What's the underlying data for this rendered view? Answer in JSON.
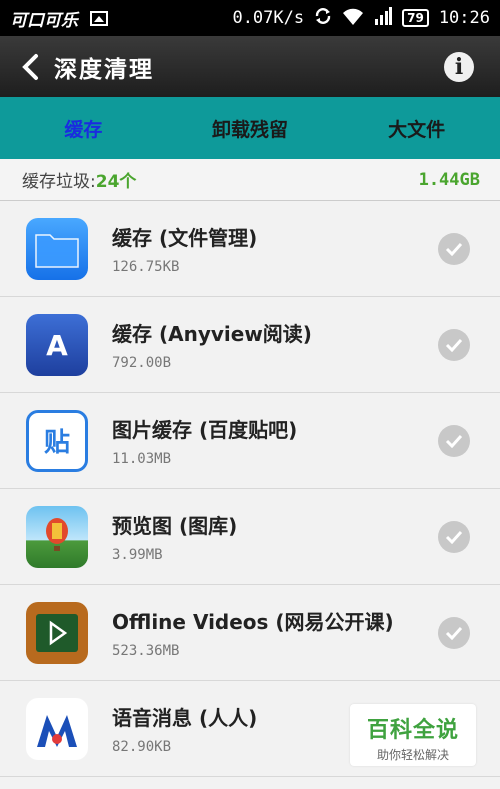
{
  "status_bar": {
    "carrier_logo": "可口可乐",
    "speed": "0.07K/s",
    "battery": "79",
    "time": "10:26"
  },
  "header": {
    "back_icon": "chevron-left-icon",
    "title": "深度清理",
    "info_icon": "info-icon"
  },
  "tabs": [
    {
      "label": "缓存",
      "active": true
    },
    {
      "label": "卸载残留",
      "active": false
    },
    {
      "label": "大文件",
      "active": false
    }
  ],
  "summary": {
    "label": "缓存垃圾:",
    "count": "24个",
    "total_size": "1.44GB"
  },
  "items": [
    {
      "name": "缓存 (文件管理)",
      "size": "126.75KB",
      "icon": "folder-icon",
      "checked": true
    },
    {
      "name": "缓存 (Anyview阅读)",
      "size": "792.00B",
      "icon": "book-icon",
      "checked": true
    },
    {
      "name": "图片缓存 (百度贴吧)",
      "size": "11.03MB",
      "icon": "tieba-icon",
      "checked": true
    },
    {
      "name": "预览图 (图库)",
      "size": "3.99MB",
      "icon": "gallery-balloon-icon",
      "checked": true
    },
    {
      "name": "Offline Videos (网易公开课)",
      "size": "523.36MB",
      "icon": "play-board-icon",
      "checked": true
    },
    {
      "name": "语音消息 (人人)",
      "size": "82.90KB",
      "icon": "renren-icon",
      "checked": true
    }
  ],
  "watermark": {
    "title": "百科全说",
    "subtitle": "助你轻松解决"
  },
  "colors": {
    "tab_bar": "#0e9a9a",
    "active_tab": "#1a2be0",
    "accent_green": "#4aa52e"
  }
}
